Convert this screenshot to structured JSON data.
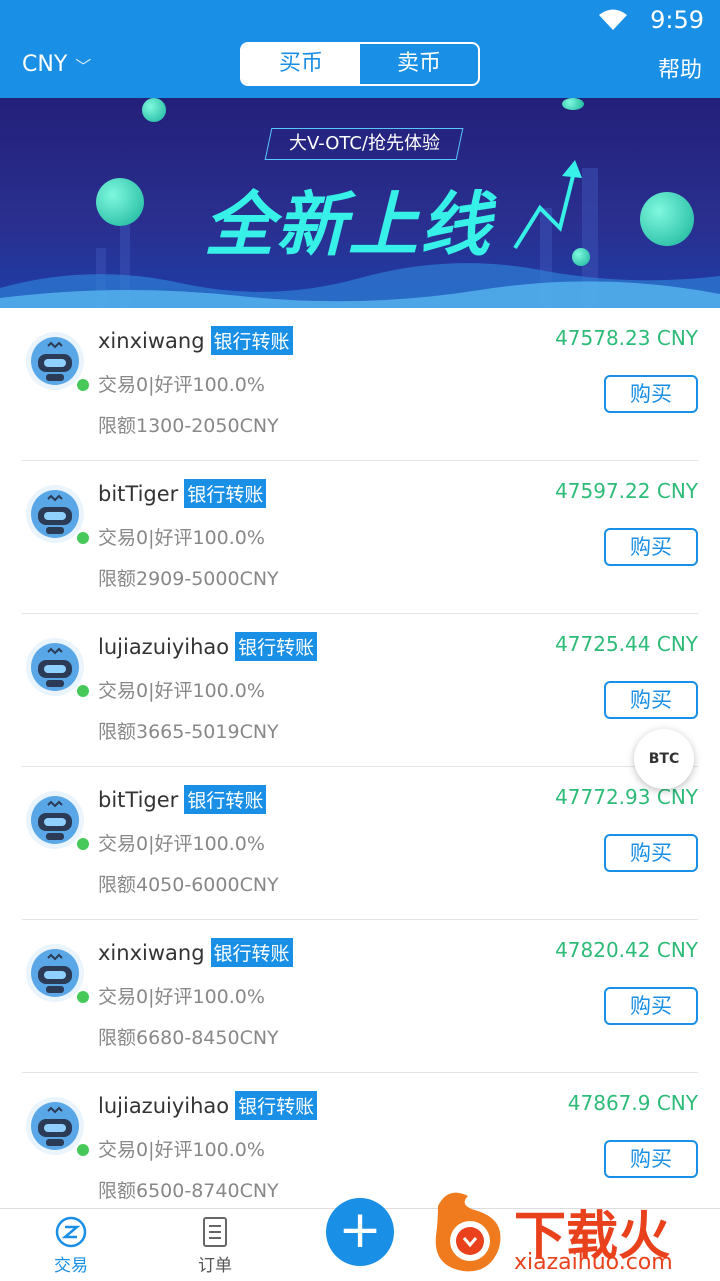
{
  "status_bar": {
    "time": "9:59"
  },
  "header": {
    "currency": "CNY",
    "tabs": [
      {
        "label": "买币"
      },
      {
        "label": "卖币"
      }
    ],
    "help": "帮助"
  },
  "banner": {
    "tag": "大V-OTC/抢先体验",
    "headline": "全新上线"
  },
  "listings": [
    {
      "name": "xinxiwang",
      "method": "银行转账",
      "stats": "交易0|好评100.0%",
      "limit": "限额1300-2050CNY",
      "price": "47578.23 CNY",
      "action": "购买"
    },
    {
      "name": "bitTiger",
      "method": "银行转账",
      "stats": "交易0|好评100.0%",
      "limit": "限额2909-5000CNY",
      "price": "47597.22 CNY",
      "action": "购买"
    },
    {
      "name": "lujiazuiyihao",
      "method": "银行转账",
      "stats": "交易0|好评100.0%",
      "limit": "限额3665-5019CNY",
      "price": "47725.44 CNY",
      "action": "购买"
    },
    {
      "name": "bitTiger",
      "method": "银行转账",
      "stats": "交易0|好评100.0%",
      "limit": "限额4050-6000CNY",
      "price": "47772.93 CNY",
      "action": "购买"
    },
    {
      "name": "xinxiwang",
      "method": "银行转账",
      "stats": "交易0|好评100.0%",
      "limit": "限额6680-8450CNY",
      "price": "47820.42 CNY",
      "action": "购买"
    },
    {
      "name": "lujiazuiyihao",
      "method": "银行转账",
      "stats": "交易0|好评100.0%",
      "limit": "限额6500-8740CNY",
      "price": "47867.9 CNY",
      "action": "购买"
    }
  ],
  "floating": {
    "coin": "BTC"
  },
  "tabbar": {
    "trade": "交易",
    "orders": "订单",
    "add": "+"
  },
  "watermark": {
    "brand": "下载火",
    "url": "xiazaihuo.com"
  },
  "colors": {
    "primary": "#1a8fe6",
    "price": "#2dbb78",
    "online": "#47c95a"
  }
}
